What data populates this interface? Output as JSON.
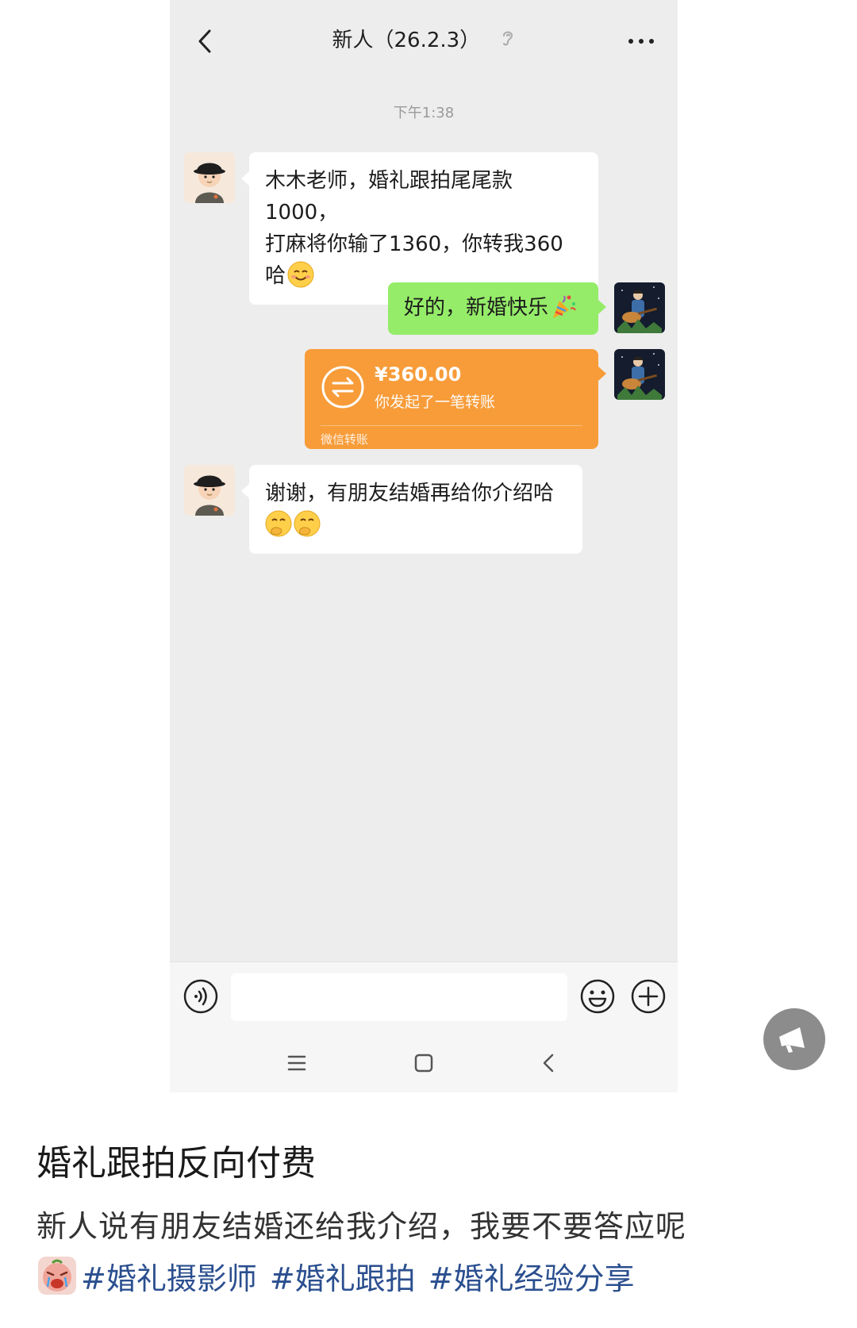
{
  "chat": {
    "title": "新人（26.2.3）",
    "time": "下午1:38"
  },
  "messages": {
    "m1_line1": "木木老师，婚礼跟拍尾尾款1000，",
    "m1_line2": "打麻将你输了1360，你转我360",
    "m1_line3": "哈",
    "m2": "好的，新婚快乐",
    "m4_line1": "谢谢，有朋友结婚再给你介绍哈"
  },
  "transfer": {
    "amount": "¥360.00",
    "note": "你发起了一笔转账",
    "footer": "微信转账"
  },
  "input": {
    "placeholder": ""
  },
  "post": {
    "title": "婚礼跟拍反向付费",
    "body": "新人说有朋友结婚还给我介绍，我要不要答应呢",
    "tags": [
      "#婚礼摄影师",
      "#婚礼跟拍",
      "#婚礼经验分享"
    ]
  },
  "icons": {
    "back": "chevron-left-icon",
    "ear": "ear-icon",
    "more": "ellipsis-icon",
    "voice": "voice-icon",
    "emoji": "smiley-icon",
    "plus": "plus-circle-icon",
    "transfer": "transfer-arrows-icon",
    "float": "megaphone-icon"
  },
  "colors": {
    "chat_bg": "#ededed",
    "sent_bubble": "#95ec69",
    "transfer_bubble": "#f79c39",
    "tag_link": "#2b4f8f"
  }
}
